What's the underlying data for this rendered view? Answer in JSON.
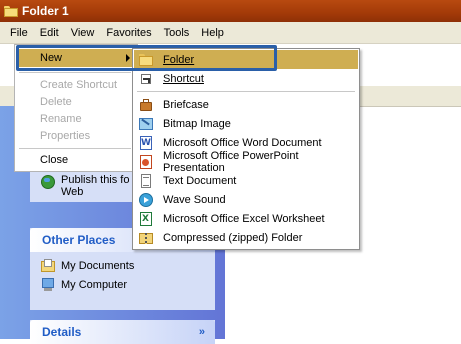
{
  "window": {
    "title": "Folder 1"
  },
  "menubar": [
    "File",
    "Edit",
    "View",
    "Favorites",
    "Tools",
    "Help"
  ],
  "file_menu": {
    "new_label": "New",
    "items_disabled": [
      "Create Shortcut",
      "Delete",
      "Rename",
      "Properties"
    ],
    "close_label": "Close"
  },
  "new_submenu": {
    "folder": {
      "label": "Folder",
      "icon": "folder-icon"
    },
    "shortcut": {
      "label": "Shortcut",
      "icon": "shortcut-icon"
    },
    "items": [
      {
        "label": "Briefcase",
        "icon": "briefcase-icon"
      },
      {
        "label": "Bitmap Image",
        "icon": "bitmap-icon"
      },
      {
        "label": "Microsoft Office Word Document",
        "icon": "word-document-icon"
      },
      {
        "label": "Microsoft Office PowerPoint Presentation",
        "icon": "powerpoint-icon"
      },
      {
        "label": "Text Document",
        "icon": "text-document-icon"
      },
      {
        "label": "Wave Sound",
        "icon": "wave-sound-icon"
      },
      {
        "label": "Microsoft Office Excel Worksheet",
        "icon": "excel-icon"
      },
      {
        "label": "Compressed (zipped) Folder",
        "icon": "zip-folder-icon"
      }
    ]
  },
  "task_pane": {
    "publish_text_line1": "Publish this fo",
    "publish_text_line2": "Web",
    "other_places_title": "Other Places",
    "other_places": [
      "My Documents",
      "My Computer"
    ],
    "details_title": "Details",
    "details_chevron": "»"
  },
  "colors": {
    "title_bar": "#a33a08",
    "menu_highlight": "#cfae52",
    "callout_border": "#2a5fa8",
    "task_pane": "#6f8ee0"
  }
}
